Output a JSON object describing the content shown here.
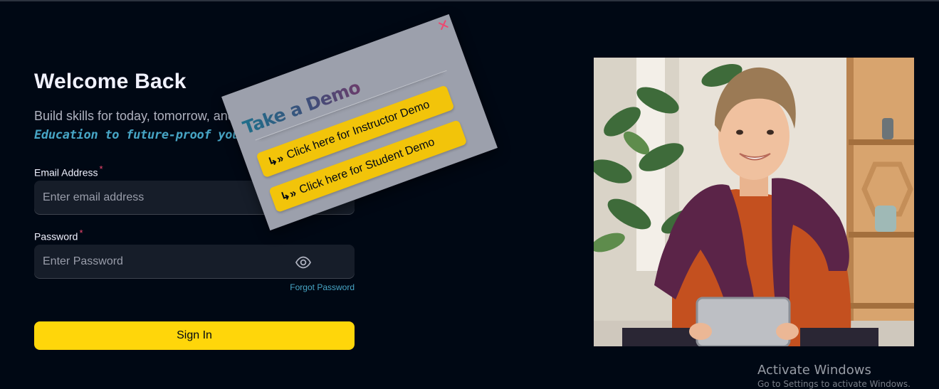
{
  "login": {
    "title": "Welcome Back",
    "subtitle": "Build skills for today, tomorrow, and beyond.",
    "subtitle_accent": "Education to future-proof your career.",
    "email_label": "Email Address",
    "email_placeholder": "Enter email address",
    "password_label": "Password",
    "password_placeholder": "Enter Password",
    "required_marker": "*",
    "forgot_label": "Forgot Password",
    "signin_label": "Sign In"
  },
  "demo": {
    "title": "Take a Demo",
    "close_glyph": "✕",
    "instructor_label": "Click here for Instructor Demo",
    "student_label": "Click here for Student Demo",
    "arrow_glyph": "↳»"
  },
  "hero_image": {
    "icon": "student-photo"
  },
  "os_watermark": {
    "title": "Activate Windows",
    "subtitle": "Go to Settings to activate Windows."
  },
  "colors": {
    "background": "#000814",
    "accent_yellow": "#FFD60A",
    "accent_blue": "#47A5C5",
    "required_pink": "#EF476F",
    "field_bg": "#161D29"
  }
}
